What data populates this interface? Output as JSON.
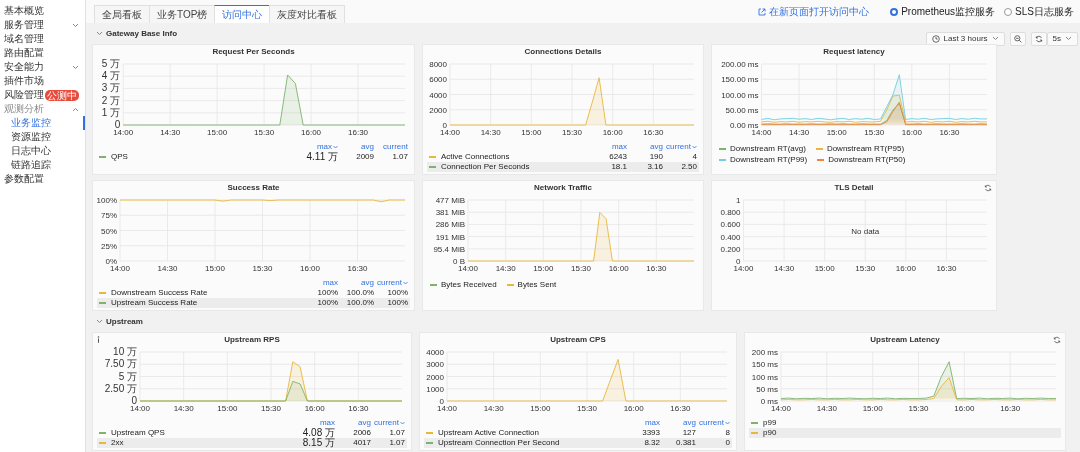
{
  "sidebar": [
    {
      "kind": "link",
      "label": "基本概览"
    },
    {
      "kind": "group",
      "label": "服务管理",
      "expanded": false
    },
    {
      "kind": "link",
      "label": "域名管理"
    },
    {
      "kind": "link",
      "label": "路由配置"
    },
    {
      "kind": "group",
      "label": "安全能力",
      "expanded": false
    },
    {
      "kind": "link",
      "label": "插件市场"
    },
    {
      "kind": "link",
      "label": "风险管理",
      "badge": "公测中"
    },
    {
      "kind": "group",
      "label": "观测分析",
      "expanded": true,
      "children": [
        {
          "label": "业务监控",
          "selected": true
        },
        {
          "label": "资源监控",
          "selected": false
        },
        {
          "label": "日志中心",
          "selected": false
        },
        {
          "label": "链路追踪",
          "selected": false
        }
      ]
    },
    {
      "kind": "link",
      "label": "参数配置"
    }
  ],
  "tabs": [
    {
      "label": "全局看板",
      "selected": false
    },
    {
      "label": "业务TOP榜",
      "selected": false
    },
    {
      "label": "访问中心",
      "selected": true
    },
    {
      "label": "灰度对比看板",
      "selected": false
    }
  ],
  "open_link": "在新页面打开访问中心",
  "sources": [
    {
      "label": "Prometheus监控服务",
      "selected": true
    },
    {
      "label": "SLS日志服务",
      "selected": false
    }
  ],
  "time_picker": {
    "range": "Last 3 hours",
    "refresh": "5s"
  },
  "sections": [
    {
      "title": "Gateway Base Info",
      "expanded": true,
      "panels": [
        {
          "title": "Request Per Seconds",
          "chart_data": {
            "type": "area",
            "grid": true,
            "categories": [
              "14:00",
              null,
              null,
              null,
              null,
              null,
              "14:30",
              null,
              null,
              null,
              null,
              null,
              "15:00",
              null,
              null,
              null,
              null,
              null,
              "15:30",
              null,
              null,
              null,
              null,
              null,
              "16:00",
              null,
              null,
              null,
              null,
              null,
              "16:30",
              null,
              null,
              null,
              null,
              null,
              null
            ],
            "ylim": [
              0,
              5
            ],
            "yticks": [
              {
                "value": 0,
                "label": "0"
              },
              {
                "value": 1,
                "label": "1 万"
              },
              {
                "value": 2,
                "label": "2 万"
              },
              {
                "value": 3,
                "label": "3 万"
              },
              {
                "value": 4,
                "label": "4 万"
              },
              {
                "value": 5,
                "label": "5 万"
              }
            ],
            "series": [
              {
                "color": "#7eb26d",
                "values": [
                  0,
                  0,
                  0,
                  0,
                  0,
                  0,
                  0,
                  0,
                  0,
                  0,
                  0,
                  0,
                  0,
                  0,
                  0,
                  0,
                  0,
                  0,
                  0,
                  0,
                  0,
                  4.1,
                  3.4,
                  0,
                  0,
                  0,
                  0,
                  0,
                  0,
                  0,
                  0,
                  0,
                  0,
                  0,
                  0,
                  0,
                  0
                ]
              }
            ]
          },
          "legend": {
            "kind": "table",
            "columns": [
              {
                "label": "max",
                "sorted": true
              },
              {
                "label": "avg",
                "sorted": false
              },
              {
                "label": "current",
                "sorted": false
              }
            ],
            "rows": [
              {
                "name": "QPS",
                "color": "#7eb26d",
                "max": "4.11 万",
                "avg": "2009",
                "current": "1.07",
                "selected": false
              }
            ]
          }
        },
        {
          "title": "Connections Details",
          "chart_data": {
            "type": "area",
            "grid": true,
            "categories": [
              "14:00",
              null,
              null,
              null,
              null,
              null,
              "14:30",
              null,
              null,
              null,
              null,
              null,
              "15:00",
              null,
              null,
              null,
              null,
              null,
              "15:30",
              null,
              null,
              null,
              null,
              null,
              "16:00",
              null,
              null,
              null,
              null,
              null,
              "16:30",
              null,
              null,
              null,
              null,
              null,
              null
            ],
            "ylim": [
              0,
              8000
            ],
            "yticks": [
              0,
              2000,
              4000,
              6000,
              8000
            ],
            "series": [
              {
                "color": "#eab839",
                "values": [
                  0,
                  0,
                  0,
                  0,
                  0,
                  0,
                  0,
                  0,
                  0,
                  0,
                  0,
                  0,
                  0,
                  0,
                  0,
                  0,
                  0,
                  0,
                  0,
                  0,
                  0,
                  3000,
                  6200,
                  0,
                  0,
                  0,
                  0,
                  0,
                  0,
                  0,
                  0,
                  0,
                  0,
                  0,
                  0,
                  0,
                  0
                ]
              }
            ]
          },
          "legend": {
            "kind": "table",
            "columns": [
              {
                "label": "max",
                "sorted": false
              },
              {
                "label": "avg",
                "sorted": false
              },
              {
                "label": "current",
                "sorted": true
              }
            ],
            "rows": [
              {
                "name": "Active Connections",
                "color": "#eab839",
                "max": "6243",
                "avg": "190",
                "current": "4",
                "selected": false
              },
              {
                "name": "Connection Per Seconds",
                "color": "#7eb26d",
                "max": "18.1",
                "avg": "3.16",
                "current": "2.50",
                "selected": true
              }
            ]
          }
        },
        {
          "title": "Request latency",
          "chart_data": {
            "type": "area",
            "grid": true,
            "categories": [
              "14:00",
              null,
              null,
              null,
              null,
              null,
              "14:30",
              null,
              null,
              null,
              null,
              null,
              "15:00",
              null,
              null,
              null,
              null,
              null,
              "15:30",
              null,
              null,
              null,
              null,
              null,
              "16:00",
              null,
              null,
              null,
              null,
              null,
              "16:30",
              null,
              null,
              null,
              null,
              null,
              null
            ],
            "ylim": [
              0,
              200
            ],
            "yticks": [
              {
                "value": 0,
                "label": "0.00 ms"
              },
              {
                "value": 50,
                "label": "50.00 ms"
              },
              {
                "value": 100,
                "label": "100.00 ms"
              },
              {
                "value": 150,
                "label": "150.00 ms"
              },
              {
                "value": 200,
                "label": "200.00 ms"
              }
            ],
            "series": [
              {
                "color": "#7eb26d",
                "values": [
                  3,
                  4,
                  3,
                  3,
                  4,
                  3,
                  3,
                  3,
                  4,
                  3,
                  3,
                  4,
                  3,
                  4,
                  3,
                  3,
                  4,
                  3,
                  3,
                  3,
                  15,
                  50,
                  70,
                  3,
                  3,
                  4,
                  3,
                  3,
                  4,
                  3,
                  3,
                  3,
                  4,
                  3,
                  3,
                  4,
                  3
                ]
              },
              {
                "color": "#eab839",
                "values": [
                  10,
                  12,
                  9,
                  11,
                  10,
                  12,
                  9,
                  11,
                  10,
                  12,
                  10,
                  9,
                  11,
                  10,
                  12,
                  9,
                  11,
                  10,
                  10,
                  12,
                  50,
                  95,
                  98,
                  10,
                  11,
                  10,
                  12,
                  9,
                  11,
                  10,
                  12,
                  9,
                  11,
                  10,
                  12,
                  10,
                  10
                ]
              },
              {
                "color": "#6ed0e0",
                "values": [
                  18,
                  22,
                  17,
                  20,
                  21,
                  22,
                  19,
                  21,
                  18,
                  22,
                  20,
                  17,
                  20,
                  22,
                  18,
                  21,
                  19,
                  22,
                  18,
                  20,
                  60,
                  100,
                  165,
                  18,
                  21,
                  19,
                  22,
                  18,
                  20,
                  21,
                  22,
                  18,
                  21,
                  19,
                  22,
                  20,
                  20
                ]
              },
              {
                "color": "#ef843c",
                "values": [
                  1,
                  1,
                  1,
                  1,
                  1,
                  1,
                  1,
                  1,
                  1,
                  1,
                  1,
                  1,
                  1,
                  1,
                  1,
                  1,
                  1,
                  1,
                  1,
                  1,
                  10,
                  45,
                  75,
                  1,
                  1,
                  1,
                  1,
                  1,
                  1,
                  1,
                  1,
                  1,
                  1,
                  1,
                  1,
                  1,
                  1
                ]
              }
            ]
          },
          "legend": {
            "kind": "inline",
            "items": [
              {
                "name": "Downstream RT(avg)",
                "color": "#7eb26d"
              },
              {
                "name": "Downstream RT(P95)",
                "color": "#eab839"
              },
              {
                "name": "Downstream RT(P99)",
                "color": "#6ed0e0"
              },
              {
                "name": "Downstream RT(P50)",
                "color": "#ef843c"
              }
            ]
          }
        },
        {
          "title": "Success Rate",
          "chart_data": {
            "type": "area",
            "grid": true,
            "categories": [
              "14:00",
              null,
              null,
              null,
              null,
              null,
              "14:30",
              null,
              null,
              null,
              null,
              null,
              "15:00",
              null,
              null,
              null,
              null,
              null,
              "15:30",
              null,
              null,
              null,
              null,
              null,
              "16:00",
              null,
              null,
              null,
              null,
              null,
              "16:30",
              null,
              null,
              null,
              null,
              null,
              null
            ],
            "ylim": [
              0,
              100
            ],
            "yticks": [
              {
                "value": 0,
                "label": "0%"
              },
              {
                "value": 25,
                "label": "25%"
              },
              {
                "value": 50,
                "label": "50%"
              },
              {
                "value": 75,
                "label": "75%"
              },
              {
                "value": 100,
                "label": "100%"
              }
            ],
            "series": [
              {
                "color": "#eab839",
                "values": [
                  100,
                  100,
                  100,
                  100,
                  100,
                  100,
                  100,
                  100,
                  100,
                  100,
                  100,
                  100,
                  100,
                  98,
                  100,
                  100,
                  100,
                  100,
                  100,
                  99,
                  100,
                  100,
                  100,
                  100,
                  100,
                  100,
                  100,
                  100,
                  100,
                  100,
                  100,
                  100,
                  100,
                  97,
                  100,
                  100,
                  100
                ]
              }
            ]
          },
          "legend": {
            "kind": "table",
            "columns": [
              {
                "label": "max",
                "sorted": false
              },
              {
                "label": "avg",
                "sorted": false
              },
              {
                "label": "current",
                "sorted": true
              }
            ],
            "rows": [
              {
                "name": "Downstream Success Rate",
                "color": "#eab839",
                "max": "100%",
                "avg": "100.0%",
                "current": "100%",
                "selected": false
              },
              {
                "name": "Upstream Success Rate",
                "color": "#7eb26d",
                "max": "100%",
                "avg": "100.0%",
                "current": "100%",
                "selected": true
              }
            ]
          }
        },
        {
          "title": "Network Traffic",
          "chart_data": {
            "type": "area",
            "grid": true,
            "categories": [
              "14:00",
              null,
              null,
              null,
              null,
              null,
              "14:30",
              null,
              null,
              null,
              null,
              null,
              "15:00",
              null,
              null,
              null,
              null,
              null,
              "15:30",
              null,
              null,
              null,
              null,
              null,
              "16:00",
              null,
              null,
              null,
              null,
              null,
              "16:30",
              null,
              null,
              null,
              null,
              null,
              null
            ],
            "ylim": [
              0,
              477
            ],
            "yticks": [
              {
                "value": 0,
                "label": "0 B"
              },
              {
                "value": 95.4,
                "label": "95.4 MiB"
              },
              {
                "value": 191,
                "label": "191 MiB"
              },
              {
                "value": 286,
                "label": "286 MiB"
              },
              {
                "value": 381,
                "label": "381 MiB"
              },
              {
                "value": 477,
                "label": "477 MiB"
              }
            ],
            "series": [
              {
                "color": "#eab839",
                "values": [
                  0,
                  0,
                  0,
                  0,
                  0,
                  0,
                  0,
                  0,
                  0,
                  0,
                  0,
                  0,
                  0,
                  0,
                  0,
                  0,
                  0,
                  0,
                  0,
                  0,
                  0,
                  380,
                  330,
                  0,
                  0,
                  0,
                  0,
                  0,
                  0,
                  0,
                  0,
                  0,
                  0,
                  0,
                  0,
                  0,
                  0
                ]
              }
            ]
          },
          "legend": {
            "kind": "inline",
            "items": [
              {
                "name": "Bytes Received",
                "color": "#7eb26d"
              },
              {
                "name": "Bytes Sent",
                "color": "#eab839"
              }
            ]
          }
        },
        {
          "title": "TLS Detail",
          "reload_icon": true,
          "no_data": "No data",
          "chart_data": {
            "type": "line",
            "grid": true,
            "categories": [
              "14:00",
              null,
              null,
              null,
              null,
              null,
              "14:30",
              null,
              null,
              null,
              null,
              null,
              "15:00",
              null,
              null,
              null,
              null,
              null,
              "15:30",
              null,
              null,
              null,
              null,
              null,
              "16:00",
              null,
              null,
              null,
              null,
              null,
              "16:30",
              null,
              null,
              null,
              null,
              null,
              null
            ],
            "ylim": [
              0,
              1
            ],
            "yticks": [
              {
                "value": 0,
                "label": "0"
              },
              {
                "value": 0.2,
                "label": "0.200"
              },
              {
                "value": 0.4,
                "label": "0.400"
              },
              {
                "value": 0.6,
                "label": "0.600"
              },
              {
                "value": 0.8,
                "label": "0.800"
              },
              {
                "value": 1,
                "label": "1"
              }
            ]
          }
        }
      ]
    },
    {
      "title": "Upstream",
      "expanded": true,
      "panels": [
        {
          "title": "Upstream RPS",
          "info_icon": true,
          "chart_data": {
            "type": "area",
            "grid": true,
            "categories": [
              "14:00",
              null,
              null,
              null,
              null,
              null,
              "14:30",
              null,
              null,
              null,
              null,
              null,
              "15:00",
              null,
              null,
              null,
              null,
              null,
              "15:30",
              null,
              null,
              null,
              null,
              null,
              "16:00",
              null,
              null,
              null,
              null,
              null,
              "16:30",
              null,
              null,
              null,
              null,
              null,
              null
            ],
            "ylim": [
              0,
              10
            ],
            "yticks": [
              {
                "value": 0,
                "label": "0"
              },
              {
                "value": 2.5,
                "label": "2.50 万"
              },
              {
                "value": 5,
                "label": "5 万"
              },
              {
                "value": 7.5,
                "label": "7.50 万"
              },
              {
                "value": 10,
                "label": "10 万"
              }
            ],
            "series": [
              {
                "color": "#eab839",
                "values": [
                  0,
                  0,
                  0,
                  0,
                  0,
                  0,
                  0,
                  0,
                  0,
                  0,
                  0,
                  0,
                  0,
                  0,
                  0,
                  0,
                  0,
                  0,
                  0,
                  0,
                  0,
                  8,
                  7,
                  0,
                  0,
                  0,
                  0,
                  0,
                  0,
                  0,
                  0,
                  0,
                  0,
                  0,
                  0,
                  0,
                  0
                ]
              },
              {
                "color": "#7eb26d",
                "values": [
                  0,
                  0,
                  0,
                  0,
                  0,
                  0,
                  0,
                  0,
                  0,
                  0,
                  0,
                  0,
                  0,
                  0,
                  0,
                  0,
                  0,
                  0,
                  0,
                  0,
                  0,
                  4,
                  3.5,
                  0,
                  0,
                  0,
                  0,
                  0,
                  0,
                  0,
                  0,
                  0,
                  0,
                  0,
                  0,
                  0,
                  0
                ]
              }
            ]
          },
          "legend": {
            "kind": "table",
            "columns": [
              {
                "label": "max",
                "sorted": false
              },
              {
                "label": "avg",
                "sorted": false
              },
              {
                "label": "current",
                "sorted": true
              }
            ],
            "rows": [
              {
                "name": "Upstream QPS",
                "color": "#7eb26d",
                "max": "4.08 万",
                "avg": "2006",
                "current": "1.07",
                "selected": false
              },
              {
                "name": "2xx",
                "color": "#eab839",
                "max": "8.15 万",
                "avg": "4017",
                "current": "1.07",
                "selected": true
              }
            ]
          }
        },
        {
          "title": "Upstream CPS",
          "chart_data": {
            "type": "area",
            "grid": true,
            "categories": [
              "14:00",
              null,
              null,
              null,
              null,
              null,
              "14:30",
              null,
              null,
              null,
              null,
              null,
              "15:00",
              null,
              null,
              null,
              null,
              null,
              "15:30",
              null,
              null,
              null,
              null,
              null,
              "16:00",
              null,
              null,
              null,
              null,
              null,
              "16:30",
              null,
              null,
              null,
              null,
              null,
              null
            ],
            "ylim": [
              0,
              4000
            ],
            "yticks": [
              0,
              1000,
              2000,
              3000,
              4000
            ],
            "series": [
              {
                "color": "#eab839",
                "values": [
                  0,
                  0,
                  0,
                  0,
                  0,
                  0,
                  0,
                  0,
                  0,
                  0,
                  0,
                  0,
                  0,
                  0,
                  0,
                  0,
                  0,
                  0,
                  0,
                  0,
                  0,
                  1700,
                  3400,
                  0,
                  0,
                  0,
                  0,
                  0,
                  0,
                  0,
                  0,
                  0,
                  0,
                  0,
                  0,
                  0,
                  0
                ]
              }
            ]
          },
          "legend": {
            "kind": "table",
            "columns": [
              {
                "label": "max",
                "sorted": false
              },
              {
                "label": "avg",
                "sorted": false
              },
              {
                "label": "current",
                "sorted": true
              }
            ],
            "rows": [
              {
                "name": "Upstream Active Connection",
                "color": "#eab839",
                "max": "3393",
                "avg": "127",
                "current": "8",
                "selected": false
              },
              {
                "name": "Upstream Connection Per Second",
                "color": "#7eb26d",
                "max": "8.32",
                "avg": "0.381",
                "current": "0",
                "selected": true
              }
            ]
          }
        },
        {
          "title": "Upstream Latency",
          "reload_icon": true,
          "chart_data": {
            "type": "area",
            "grid": true,
            "categories": [
              "14:00",
              null,
              null,
              null,
              null,
              null,
              "14:30",
              null,
              null,
              null,
              null,
              null,
              "15:00",
              null,
              null,
              null,
              null,
              null,
              "15:30",
              null,
              null,
              null,
              null,
              null,
              "16:00",
              null,
              null,
              null,
              null,
              null,
              "16:30",
              null,
              null,
              null,
              null,
              null,
              null
            ],
            "ylim": [
              0,
              200
            ],
            "yticks": [
              {
                "value": 0,
                "label": "0 ms"
              },
              {
                "value": 50,
                "label": "50 ms"
              },
              {
                "value": 100,
                "label": "100 ms"
              },
              {
                "value": 150,
                "label": "150 ms"
              },
              {
                "value": 200,
                "label": "200 ms"
              }
            ],
            "series": [
              {
                "color": "#7eb26d",
                "values": [
                  10,
                  12,
                  9,
                  11,
                  10,
                  12,
                  9,
                  11,
                  10,
                  12,
                  10,
                  9,
                  11,
                  10,
                  12,
                  9,
                  11,
                  10,
                  10,
                  12,
                  20,
                  100,
                  160,
                  10,
                  11,
                  10,
                  12,
                  9,
                  11,
                  10,
                  12,
                  9,
                  11,
                  10,
                  12,
                  10,
                  10
                ]
              },
              {
                "color": "#eab839",
                "values": [
                  5,
                  6,
                  5,
                  5,
                  6,
                  5,
                  5,
                  6,
                  5,
                  5,
                  6,
                  5,
                  5,
                  6,
                  5,
                  5,
                  6,
                  5,
                  5,
                  6,
                  10,
                  60,
                  95,
                  5,
                  5,
                  6,
                  5,
                  5,
                  6,
                  5,
                  5,
                  6,
                  5,
                  5,
                  6,
                  5,
                  5
                ]
              }
            ]
          },
          "legend": {
            "kind": "table",
            "rows": [
              {
                "name": "p99",
                "color": "#7eb26d",
                "selected": false
              },
              {
                "name": "p90",
                "color": "#eab839",
                "selected": true
              }
            ]
          }
        }
      ]
    }
  ]
}
